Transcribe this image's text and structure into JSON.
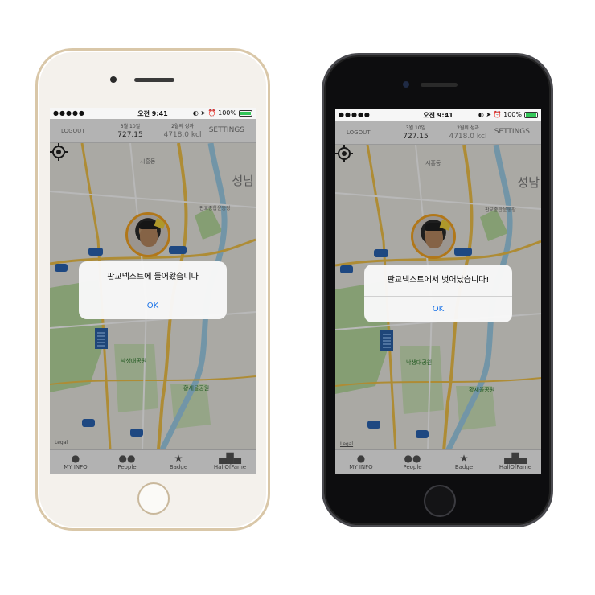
{
  "phones": [
    {
      "status": {
        "signal": "●●●●● ",
        "time": "오전 9:41",
        "right": "◐ ➤ ⏰ 100%"
      },
      "topbar": {
        "logout": "LOGOUT",
        "today_label": "3월 10일",
        "today_value": "727.15",
        "month_label": "2월의 성과",
        "month_value": "4718.0 kcl",
        "settings": "SETTINGS"
      },
      "map": {
        "city": "성남",
        "legal": "Legal",
        "labels": [
          "시흥동",
          "판교종합운동장",
          "낙생대공원",
          "황새울공원"
        ],
        "road_badges": [
          "100",
          "1",
          "57"
        ]
      },
      "alert": {
        "message": "판교넥스트에 들어왔습니다",
        "ok": "OK"
      },
      "tabs": [
        "MY INFO",
        "People",
        "Badge",
        "HallOfFame"
      ]
    },
    {
      "status": {
        "signal": "●●●●● ",
        "time": "오전 9:41",
        "right": "◐ ➤ ⏰ 100%"
      },
      "topbar": {
        "logout": "LOGOUT",
        "today_label": "3월 10일",
        "today_value": "727.15",
        "month_label": "2월의 성과",
        "month_value": "4718.0 kcl",
        "settings": "SETTINGS"
      },
      "map": {
        "city": "성남",
        "legal": "Legal",
        "labels": [
          "시흥동",
          "판교종합운동장",
          "낙생대공원",
          "황새울공원"
        ],
        "road_badges": [
          "100",
          "1",
          "57"
        ]
      },
      "alert": {
        "message": "판교넥스트에서 벗어났습니다!",
        "ok": "OK"
      },
      "tabs": [
        "MY INFO",
        "People",
        "Badge",
        "HallOfFame"
      ]
    }
  ],
  "icons": [
    "wifi-icon",
    "location-target-icon",
    "person-icon",
    "people-icon",
    "star-icon",
    "podium-icon"
  ],
  "colors": {
    "accent": "#1a73e8",
    "park": "#b9dca0",
    "river": "#9fcfe8",
    "highway": "#f2c24a",
    "building": "#2b62a8",
    "avatar_ring": "#f5a623"
  }
}
